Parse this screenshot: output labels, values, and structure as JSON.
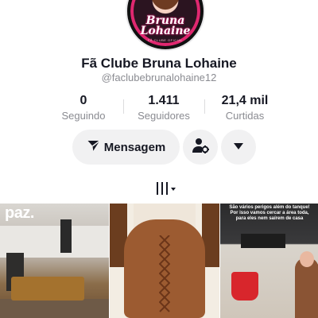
{
  "profile": {
    "name": "Fã Clube Bruna Lohaine",
    "handle": "@faclubebrunalohaine12",
    "avatar_logo_line1": "Bruna",
    "avatar_logo_line2": "Lohaine",
    "avatar_subtext": "FÃ CLUBE OFICIAL"
  },
  "stats": [
    {
      "value": "0",
      "label": "Seguindo"
    },
    {
      "value": "1.411",
      "label": "Seguidores"
    },
    {
      "value": "21,4 mil",
      "label": "Curtidas"
    }
  ],
  "actions": {
    "message_label": "Mensagem",
    "message_icon": "send-icon",
    "follow_icon": "user-settings-icon",
    "more_icon": "chevron-down-icon"
  },
  "tabs": {
    "videos_icon": "grid-bars-icon"
  },
  "videos": [
    {
      "overlay_text": "paz."
    },
    {
      "overlay_text": ""
    },
    {
      "overlay_text": "São vários perigos além do tanque! Por isso vamos cercar a área toda, para eles nem saírem de casa"
    }
  ],
  "colors": {
    "text": "#161823",
    "secondary_text": "#8a8b91",
    "button_bg": "#f1f1f2",
    "avatar_accent": "#e02870"
  }
}
